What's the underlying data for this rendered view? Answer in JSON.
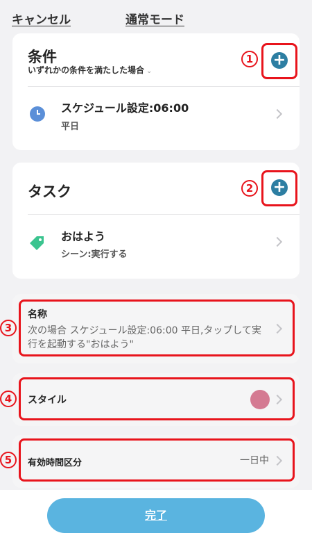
{
  "header": {
    "cancel_label": "キャンセル",
    "title": "通常モード"
  },
  "conditions": {
    "title": "条件",
    "subtitle": "いずれかの条件を満たした場合",
    "caret": "⌄",
    "marker": "1",
    "item": {
      "icon": "clock-icon",
      "title": "スケジュール設定:06:00",
      "subtitle": "平日"
    }
  },
  "tasks": {
    "title": "タスク",
    "marker": "2",
    "item": {
      "icon": "tag-icon",
      "title": "おはよう",
      "subtitle": "シーン:実行する"
    }
  },
  "name_setting": {
    "marker": "3",
    "label": "名称",
    "value": "次の場合 スケジュール設定:06:00 平日,タップして実行を起動する\"おはよう\""
  },
  "style_setting": {
    "marker": "4",
    "label": "スタイル",
    "color": "#d47a92"
  },
  "time_setting": {
    "marker": "5",
    "label": "有効時間区分",
    "value": "一日中"
  },
  "footer": {
    "done_label": "完了"
  },
  "colors": {
    "accent": "#2d7ea2",
    "highlight": "#e8141c",
    "button": "#5ab4e0"
  }
}
